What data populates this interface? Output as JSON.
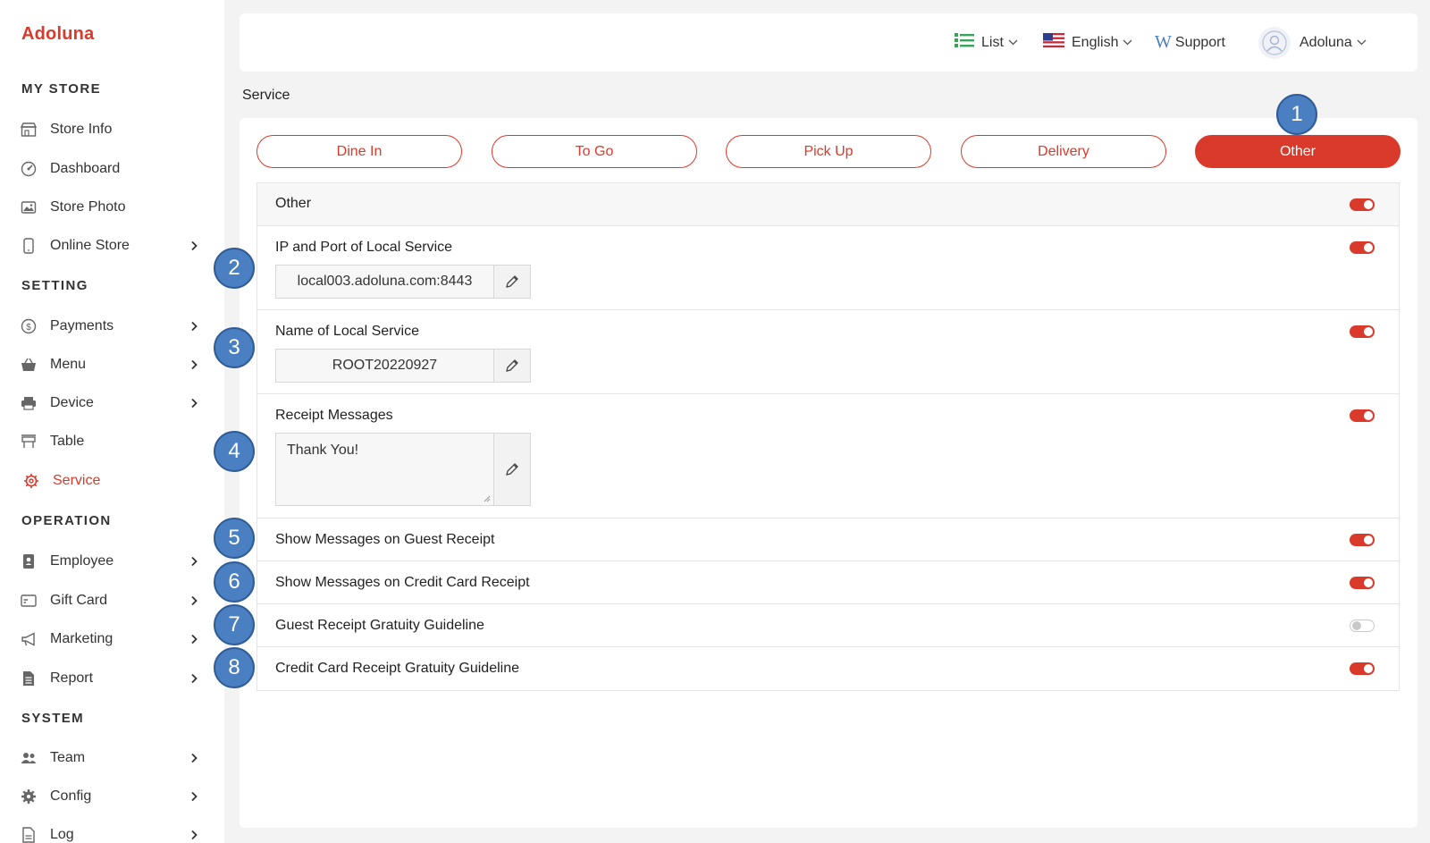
{
  "brand": "Adoluna",
  "sidebar": {
    "sections": [
      {
        "title": "MY STORE"
      },
      {
        "title": "SETTING"
      },
      {
        "title": "OPERATION"
      },
      {
        "title": "SYSTEM"
      }
    ],
    "items": [
      {
        "label": "Store Info",
        "icon": "store-icon"
      },
      {
        "label": "Dashboard",
        "icon": "gauge-icon"
      },
      {
        "label": "Store Photo",
        "icon": "photo-icon"
      },
      {
        "label": "Online Store",
        "icon": "phone-icon"
      },
      {
        "label": "Payments",
        "icon": "dollar-icon"
      },
      {
        "label": "Menu",
        "icon": "basket-icon"
      },
      {
        "label": "Device",
        "icon": "printer-icon"
      },
      {
        "label": "Table",
        "icon": "table-icon"
      },
      {
        "label": "Service",
        "icon": "gear-icon"
      },
      {
        "label": "Employee",
        "icon": "badge-icon"
      },
      {
        "label": "Gift Card",
        "icon": "card-icon"
      },
      {
        "label": "Marketing",
        "icon": "megaphone-icon"
      },
      {
        "label": "Report",
        "icon": "report-icon"
      },
      {
        "label": "Team",
        "icon": "team-icon"
      },
      {
        "label": "Config",
        "icon": "cog-icon"
      },
      {
        "label": "Log",
        "icon": "log-icon"
      }
    ]
  },
  "header": {
    "view": "List",
    "language": "English",
    "support": "Support",
    "user": "Adoluna"
  },
  "page_title": "Service",
  "tabs": [
    {
      "label": "Dine In"
    },
    {
      "label": "To Go"
    },
    {
      "label": "Pick Up"
    },
    {
      "label": "Delivery"
    },
    {
      "label": "Other"
    }
  ],
  "rows": {
    "other": {
      "title": "Other",
      "enabled": true
    },
    "ip_port": {
      "title": "IP and Port of Local Service",
      "value": "local003.adoluna.com:8443",
      "enabled": true
    },
    "name": {
      "title": "Name of Local Service",
      "value": "ROOT20220927",
      "enabled": true
    },
    "receipt": {
      "title": "Receipt Messages",
      "value": "Thank You!",
      "enabled": true
    },
    "guest_msg": {
      "title": "Show Messages on Guest Receipt",
      "enabled": true
    },
    "cc_msg": {
      "title": "Show Messages on Credit Card Receipt",
      "enabled": true
    },
    "guest_grat": {
      "title": "Guest Receipt Gratuity Guideline",
      "enabled": false
    },
    "cc_grat": {
      "title": "Credit Card Receipt Gratuity Guideline",
      "enabled": true
    }
  },
  "callouts": [
    "1",
    "2",
    "3",
    "4",
    "5",
    "6",
    "7",
    "8"
  ],
  "colors": {
    "accent": "#d93a2b",
    "callout": "#4a7fc1"
  }
}
